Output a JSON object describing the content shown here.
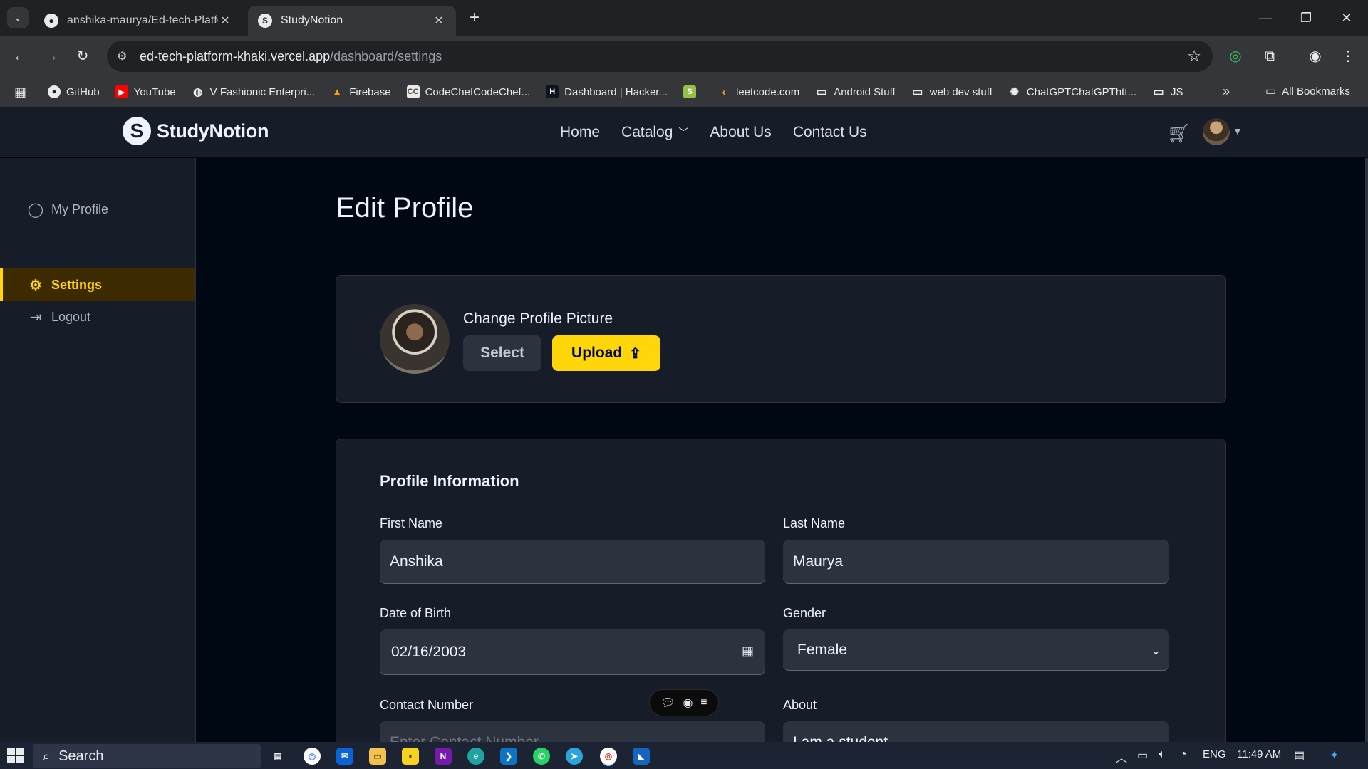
{
  "browser": {
    "tabs": [
      {
        "title": "anshika-maurya/Ed-tech-Platfo",
        "icon": "github-icon",
        "active": false
      },
      {
        "title": "StudyNotion",
        "icon": "studynotion-icon",
        "active": true
      }
    ],
    "url_host": "ed-tech-platform-khaki.vercel.app",
    "url_path": "/dashboard/settings",
    "bookmarks": [
      {
        "label": "GitHub",
        "icon": "github-icon"
      },
      {
        "label": "YouTube",
        "icon": "youtube-icon"
      },
      {
        "label": "V Fashionic Enterpri...",
        "icon": "globe-icon"
      },
      {
        "label": "Firebase",
        "icon": "firebase-icon"
      },
      {
        "label": "CodeChefCodeChef...",
        "icon": "codechef-icon"
      },
      {
        "label": "Dashboard | Hacker...",
        "icon": "hackerrank-icon"
      },
      {
        "label": "",
        "icon": "shopify-icon"
      },
      {
        "label": "leetcode.com",
        "icon": "leetcode-icon"
      },
      {
        "label": "Android Stuff",
        "icon": "folder-icon"
      },
      {
        "label": "web dev stuff",
        "icon": "folder-icon"
      },
      {
        "label": "ChatGPTChatGPThtt...",
        "icon": "chatgpt-icon"
      },
      {
        "label": "JS",
        "icon": "folder-icon"
      }
    ],
    "all_bookmarks": "All Bookmarks"
  },
  "site": {
    "logo_letter": "S",
    "brand": "StudyNotion",
    "nav": {
      "home": "Home",
      "catalog": "Catalog",
      "about": "About Us",
      "contact": "Contact Us"
    }
  },
  "sidebar": {
    "my_profile": "My Profile",
    "settings": "Settings",
    "logout": "Logout"
  },
  "main": {
    "title": "Edit Profile",
    "picture": {
      "title": "Change Profile Picture",
      "select": "Select",
      "upload": "Upload"
    },
    "info": {
      "title": "Profile Information",
      "first_name_label": "First Name",
      "first_name": "Anshika",
      "last_name_label": "Last Name",
      "last_name": "Maurya",
      "dob_label": "Date of Birth",
      "dob": "02/16/2003",
      "gender_label": "Gender",
      "gender": "Female",
      "contact_label": "Contact Number",
      "contact_placeholder": "Enter Contact Number",
      "about_label": "About",
      "about": "I am a student"
    }
  },
  "taskbar": {
    "search": "Search",
    "lang": "ENG",
    "time": "11:49 AM"
  },
  "colors": {
    "accent": "#ffd60a",
    "background": "#000814",
    "card": "#161d29"
  }
}
